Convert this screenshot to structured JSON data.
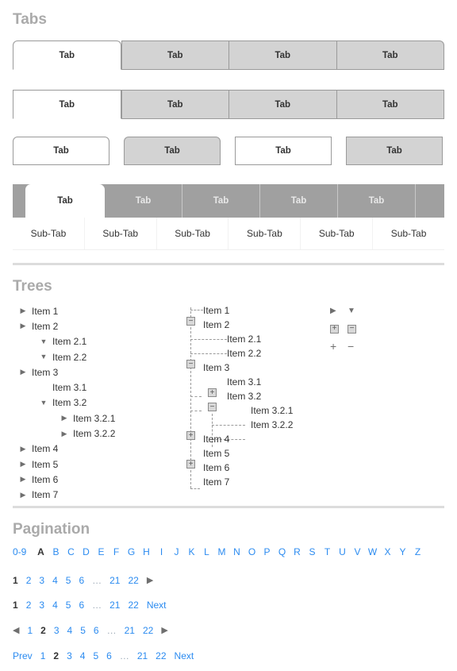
{
  "sections": {
    "tabs_title": "Tabs",
    "trees_title": "Trees",
    "pagination_title": "Pagination"
  },
  "colors": {
    "link": "#2b8bf0",
    "heading": "#aaaaaa",
    "tab_inactive_bg": "#d3d3d3",
    "tab_active_bg": "#ffffff",
    "tab_border": "#9a9a9a",
    "dark_bar_bg": "#a0a0a0",
    "divider": "#dcdcdc",
    "text": "#333333"
  },
  "tab_rows": [
    {
      "name": "rounded-joined",
      "tabs": [
        {
          "label": "Tab",
          "active": true
        },
        {
          "label": "Tab",
          "active": false
        },
        {
          "label": "Tab",
          "active": false
        },
        {
          "label": "Tab",
          "active": false
        }
      ]
    },
    {
      "name": "square-joined",
      "tabs": [
        {
          "label": "Tab",
          "active": true
        },
        {
          "label": "Tab",
          "active": false
        },
        {
          "label": "Tab",
          "active": false
        },
        {
          "label": "Tab",
          "active": false
        }
      ]
    },
    {
      "name": "separated",
      "tabs": [
        {
          "label": "Tab",
          "active": true
        },
        {
          "label": "Tab",
          "active": false
        },
        {
          "label": "Tab",
          "active": true
        },
        {
          "label": "Tab",
          "active": false
        }
      ]
    }
  ],
  "dark_tab_bar": {
    "tabs": [
      {
        "label": "Tab",
        "active": true
      },
      {
        "label": "Tab",
        "active": false
      },
      {
        "label": "Tab",
        "active": false
      },
      {
        "label": "Tab",
        "active": false
      },
      {
        "label": "Tab",
        "active": false
      }
    ]
  },
  "sub_tabs": [
    {
      "label": "Sub-Tab"
    },
    {
      "label": "Sub-Tab"
    },
    {
      "label": "Sub-Tab"
    },
    {
      "label": "Sub-Tab"
    },
    {
      "label": "Sub-Tab"
    },
    {
      "label": "Sub-Tab"
    }
  ],
  "tree_left": [
    {
      "label": "Item 1",
      "indent": 0,
      "arrow": "collapsed"
    },
    {
      "label": "Item 2",
      "indent": 0,
      "arrow": "collapsed"
    },
    {
      "label": "Item 2.1",
      "indent": 1,
      "arrow": "expanded"
    },
    {
      "label": "Item 2.2",
      "indent": 1,
      "arrow": "expanded"
    },
    {
      "label": "Item 3",
      "indent": 0,
      "arrow": "collapsed"
    },
    {
      "label": "Item 3.1",
      "indent": 1,
      "arrow": "none"
    },
    {
      "label": "Item 3.2",
      "indent": 1,
      "arrow": "expanded"
    },
    {
      "label": "Item 3.2.1",
      "indent": 2,
      "arrow": "collapsed"
    },
    {
      "label": "Item 3.2.2",
      "indent": 2,
      "arrow": "collapsed"
    },
    {
      "label": "Item 4",
      "indent": 0,
      "arrow": "collapsed"
    },
    {
      "label": "Item 5",
      "indent": 0,
      "arrow": "collapsed"
    },
    {
      "label": "Item 6",
      "indent": 0,
      "arrow": "collapsed"
    },
    {
      "label": "Item 7",
      "indent": 0,
      "arrow": "collapsed"
    }
  ],
  "tree_right": [
    {
      "label": "Item 1",
      "toggle": "none"
    },
    {
      "label": "Item 2",
      "toggle": "minus"
    },
    {
      "label": "Item 2.1",
      "toggle": "none"
    },
    {
      "label": "Item 2.2",
      "toggle": "none"
    },
    {
      "label": "Item 3",
      "toggle": "minus"
    },
    {
      "label": "Item 3.1",
      "toggle": "plus"
    },
    {
      "label": "Item 3.2",
      "toggle": "minus"
    },
    {
      "label": "Item 3.2.1",
      "toggle": "none"
    },
    {
      "label": "Item 3.2.2",
      "toggle": "none"
    },
    {
      "label": "Item 4",
      "toggle": "plus"
    },
    {
      "label": "Item 5",
      "toggle": "none"
    },
    {
      "label": "Item 6",
      "toggle": "plus"
    },
    {
      "label": "Item 7",
      "toggle": "none"
    }
  ],
  "tree_legend": {
    "row1": [
      "triangle-right-icon",
      "triangle-down-icon"
    ],
    "row2": [
      "plus-box-icon",
      "minus-box-icon"
    ],
    "row3": [
      "plus-icon",
      "minus-icon"
    ]
  },
  "pagination": {
    "alphabet": [
      {
        "label": "0-9",
        "active": false
      },
      {
        "label": "A",
        "active": true
      },
      {
        "label": "B",
        "active": false
      },
      {
        "label": "C",
        "active": false
      },
      {
        "label": "D",
        "active": false
      },
      {
        "label": "E",
        "active": false
      },
      {
        "label": "F",
        "active": false
      },
      {
        "label": "G",
        "active": false
      },
      {
        "label": "H",
        "active": false
      },
      {
        "label": "I",
        "active": false
      },
      {
        "label": "J",
        "active": false
      },
      {
        "label": "K",
        "active": false
      },
      {
        "label": "L",
        "active": false
      },
      {
        "label": "M",
        "active": false
      },
      {
        "label": "N",
        "active": false
      },
      {
        "label": "O",
        "active": false
      },
      {
        "label": "P",
        "active": false
      },
      {
        "label": "Q",
        "active": false
      },
      {
        "label": "R",
        "active": false
      },
      {
        "label": "S",
        "active": false
      },
      {
        "label": "T",
        "active": false
      },
      {
        "label": "U",
        "active": false
      },
      {
        "label": "V",
        "active": false
      },
      {
        "label": "W",
        "active": false
      },
      {
        "label": "X",
        "active": false
      },
      {
        "label": "Y",
        "active": false
      },
      {
        "label": "Z",
        "active": false
      }
    ],
    "row_arrow_next": {
      "pages": [
        "1",
        "2",
        "3",
        "4",
        "5",
        "6",
        "…",
        "21",
        "22"
      ],
      "active_index": 0,
      "next_icon": "triangle-right-icon"
    },
    "row_text_next": {
      "pages": [
        "1",
        "2",
        "3",
        "4",
        "5",
        "6",
        "…",
        "21",
        "22"
      ],
      "active_index": 0,
      "next_label": "Next"
    },
    "row_both_arrows": {
      "prev_icon": "triangle-left-icon",
      "pages": [
        "1",
        "2",
        "3",
        "4",
        "5",
        "6",
        "…",
        "21",
        "22"
      ],
      "active_index": 1,
      "next_icon": "triangle-right-icon"
    },
    "row_both_text": {
      "prev_label": "Prev",
      "pages": [
        "1",
        "2",
        "3",
        "4",
        "5",
        "6",
        "…",
        "21",
        "22"
      ],
      "active_index": 1,
      "next_label": "Next"
    }
  }
}
